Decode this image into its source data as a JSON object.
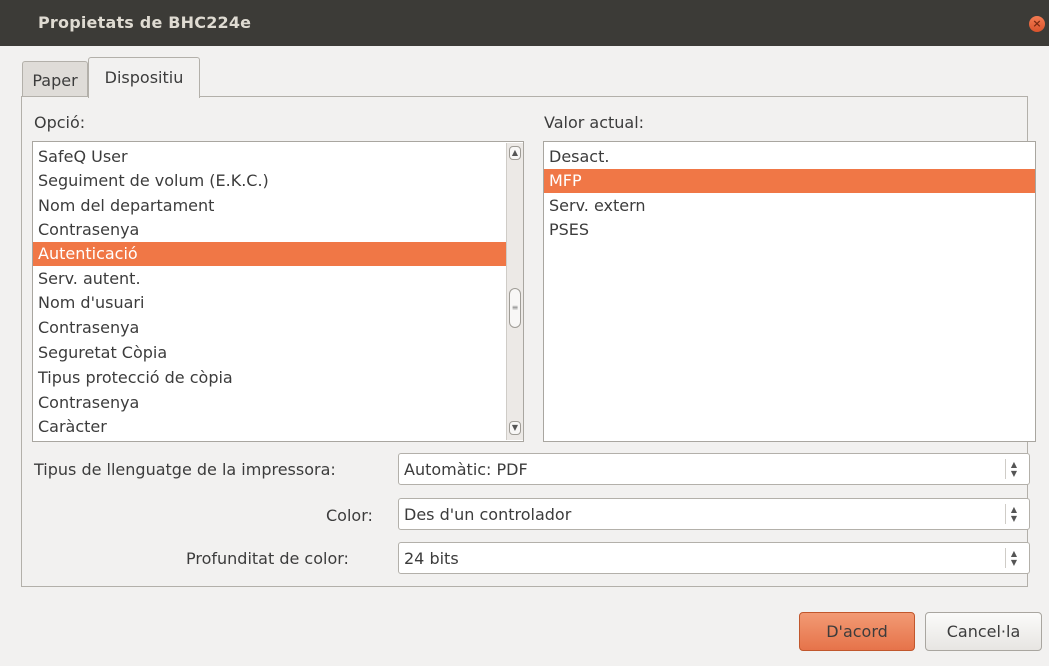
{
  "window": {
    "title": "Propietats de BHC224e"
  },
  "tabs": [
    {
      "label": "Paper",
      "active": false
    },
    {
      "label": "Dispositiu",
      "active": true
    }
  ],
  "options_panel": {
    "label": "Opció:",
    "items": [
      "SafeQ User",
      "Seguiment de volum (E.K.C.)",
      "Nom del departament",
      "Contrasenya",
      "Autenticació",
      "Serv. autent.",
      "Nom d'usuari",
      "Contrasenya",
      "Seguretat Còpia",
      "Tipus protecció de còpia",
      "Contrasenya",
      "Caràcter"
    ],
    "selected_index": 4
  },
  "values_panel": {
    "label": "Valor actual:",
    "items": [
      "Desact.",
      "MFP",
      "Serv. extern",
      "PSES"
    ],
    "selected_index": 1
  },
  "settings": [
    {
      "label": "Tipus de llenguatge de la impressora:",
      "value": "Automàtic: PDF"
    },
    {
      "label": "Color:",
      "value": "Des d'un controlador"
    },
    {
      "label": "Profunditat de color:",
      "value": "24 bits"
    }
  ],
  "buttons": {
    "ok": "D'acord",
    "cancel": "Cancel·la"
  },
  "colors": {
    "accent": "#f07746",
    "titlebar": "#3c3b37",
    "background": "#f2f1f0"
  }
}
